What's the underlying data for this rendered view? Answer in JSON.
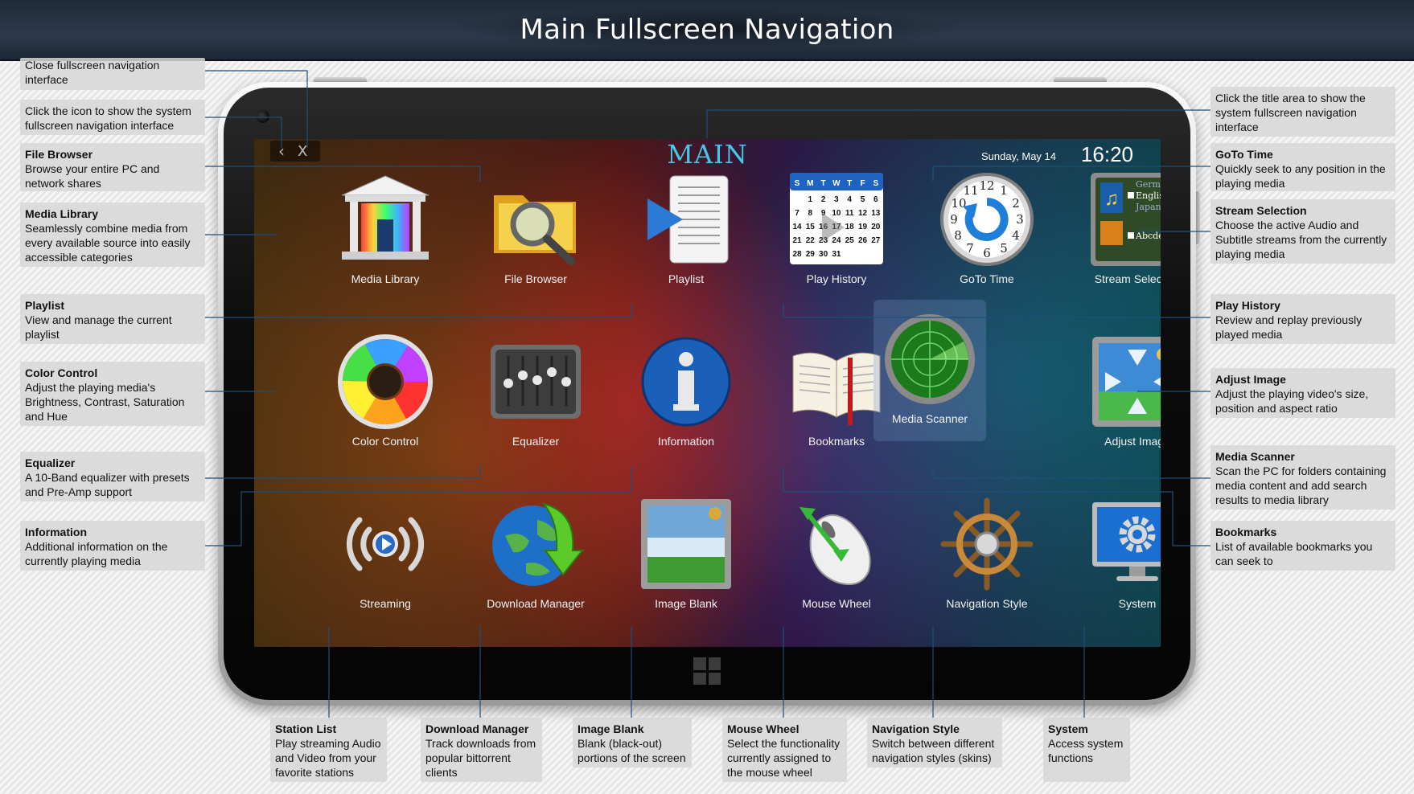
{
  "header": {
    "title": "Main Fullscreen Navigation"
  },
  "screen": {
    "title": "MAIN",
    "back_symbol": "‹",
    "close_symbol": "X",
    "date": "Sunday, May 14",
    "time": "16:20",
    "accent_color": "#48c6e6",
    "tiles": [
      {
        "label": "Media Library",
        "icon": "media-library-icon"
      },
      {
        "label": "File Browser",
        "icon": "file-browser-icon"
      },
      {
        "label": "Playlist",
        "icon": "playlist-icon"
      },
      {
        "label": "Play History",
        "icon": "play-history-icon"
      },
      {
        "label": "GoTo Time",
        "icon": "goto-time-icon"
      },
      {
        "label": "Stream Selection",
        "icon": "stream-selection-icon"
      },
      {
        "label": "Color Control",
        "icon": "color-control-icon"
      },
      {
        "label": "Equalizer",
        "icon": "equalizer-icon"
      },
      {
        "label": "Information",
        "icon": "information-icon"
      },
      {
        "label": "Bookmarks",
        "icon": "bookmarks-icon"
      },
      {
        "label": "Media Scanner",
        "icon": "media-scanner-icon",
        "selected": true
      },
      {
        "label": "Adjust Image",
        "icon": "adjust-image-icon"
      },
      {
        "label": "Streaming",
        "icon": "streaming-icon"
      },
      {
        "label": "Download Manager",
        "icon": "download-manager-icon"
      },
      {
        "label": "Image Blank",
        "icon": "image-blank-icon"
      },
      {
        "label": "Mouse Wheel",
        "icon": "mouse-wheel-icon"
      },
      {
        "label": "Navigation Style",
        "icon": "navigation-style-icon"
      },
      {
        "label": "System",
        "icon": "system-icon"
      }
    ],
    "play_history_calendar": {
      "weekdays": [
        "S",
        "M",
        "T",
        "W",
        "T",
        "F",
        "S"
      ],
      "days": [
        "",
        "1",
        "2",
        "3",
        "4",
        "5",
        "6",
        "7",
        "8",
        "9",
        "10",
        "11",
        "12",
        "13",
        "14",
        "15",
        "16",
        "17",
        "18",
        "19",
        "20",
        "21",
        "22",
        "23",
        "24",
        "25",
        "26",
        "27",
        "28",
        "29",
        "30",
        "31"
      ]
    },
    "stream_languages": [
      "German",
      "English",
      "Japanese",
      "Abcdef"
    ]
  },
  "callouts": {
    "close": {
      "title": "",
      "text": "Close fullscreen navigation interface"
    },
    "icon": {
      "title": "",
      "text": "Click the icon to show the system fullscreen navigation interface"
    },
    "file_browser": {
      "title": "File Browser",
      "text": "Browse your entire PC and network shares"
    },
    "media_library": {
      "title": "Media Library",
      "text": "Seamlessly combine media from every available source into easily accessible categories"
    },
    "playlist": {
      "title": "Playlist",
      "text": "View and manage the current playlist"
    },
    "color_control": {
      "title": "Color Control",
      "text": "Adjust the playing media's Brightness, Contrast, Saturation and Hue"
    },
    "equalizer": {
      "title": "Equalizer",
      "text": "A 10-Band equalizer with presets and Pre-Amp support"
    },
    "information": {
      "title": "Information",
      "text": "Additional information on the currently playing media"
    },
    "title_area": {
      "title": "",
      "text": "Click the title area to show the system fullscreen navigation interface"
    },
    "goto_time": {
      "title": "GoTo Time",
      "text": "Quickly seek to any position in the playing media"
    },
    "stream_selection": {
      "title": "Stream Selection",
      "text": "Choose the active Audio and Subtitle streams from the currently playing media"
    },
    "play_history": {
      "title": "Play History",
      "text": "Review and replay previously played media"
    },
    "adjust_image": {
      "title": "Adjust Image",
      "text": "Adjust the playing video's size, position and aspect ratio"
    },
    "media_scanner": {
      "title": "Media Scanner",
      "text": "Scan the PC for folders containing media content and add search results to media library"
    },
    "bookmarks": {
      "title": "Bookmarks",
      "text": "List of available bookmarks you can seek to"
    },
    "station_list": {
      "title": "Station List",
      "text": "Play streaming Audio and Video from your favorite stations"
    },
    "download_manager": {
      "title": "Download Manager",
      "text": "Track downloads from popular bittorrent clients"
    },
    "image_blank": {
      "title": "Image Blank",
      "text": "Blank (black-out) portions of the screen"
    },
    "mouse_wheel": {
      "title": "Mouse Wheel",
      "text": "Select the functionality currently assigned to the mouse wheel"
    },
    "navigation_style": {
      "title": "Navigation Style",
      "text": "Switch between different navigation styles (skins)"
    },
    "system": {
      "title": "System",
      "text": "Access system functions"
    }
  }
}
